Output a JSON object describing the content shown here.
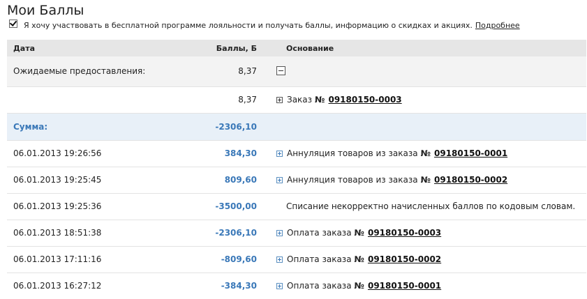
{
  "page": {
    "title": "Мои Баллы",
    "optin_text": "Я хочу участвовать в бесплатной программе лояльности и получать баллы, информацию о скидках и акциях.",
    "optin_link": "Подробнее",
    "optin_checked": true
  },
  "table": {
    "headers": {
      "date": "Дата",
      "amount": "Баллы, Б",
      "basis": "Основание"
    },
    "expected": {
      "label": "Ожидаемые предоставления:",
      "amount": "8,37"
    },
    "expected_item": {
      "amount": "8,37",
      "basis_text": "Заказ",
      "no": "№",
      "order": "09180150-0003"
    },
    "sum": {
      "label": "Сумма:",
      "amount": "-2306,10"
    },
    "rows": [
      {
        "date": "06.01.2013 19:26:56",
        "amount": "384,30",
        "basis_text": "Аннуляция товаров из заказа",
        "no": "№",
        "order": "09180150-0001"
      },
      {
        "date": "06.01.2013 19:25:45",
        "amount": "809,60",
        "basis_text": "Аннуляция товаров из заказа",
        "no": "№",
        "order": "09180150-0002"
      },
      {
        "date": "06.01.2013 19:25:36",
        "amount": "-3500,00",
        "basis_text": "Списание некорректно начисленных баллов по кодовым словам."
      },
      {
        "date": "06.01.2013 18:51:38",
        "amount": "-2306,10",
        "basis_text": "Оплата заказа",
        "no": "№",
        "order": "09180150-0003"
      },
      {
        "date": "06.01.2013 17:11:16",
        "amount": "-809,60",
        "basis_text": "Оплата заказа",
        "no": "№",
        "order": "09180150-0002"
      },
      {
        "date": "06.01.2013 16:27:12",
        "amount": "-384,30",
        "basis_text": "Оплата заказа",
        "no": "№",
        "order": "09180150-0001"
      }
    ]
  },
  "colors": {
    "accent": "#3a78b8",
    "header_bg": "#e6e6e6",
    "sum_bg": "#e8f0f8"
  }
}
